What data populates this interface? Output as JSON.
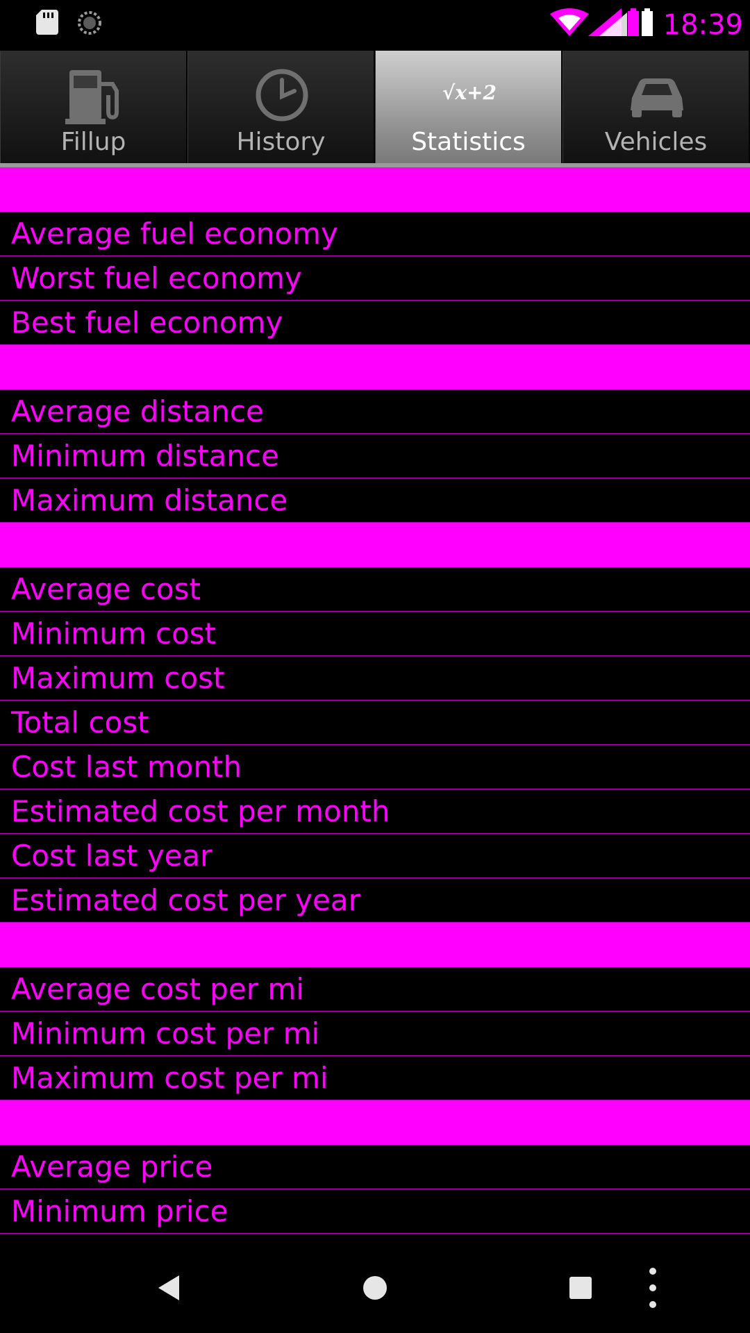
{
  "status_bar": {
    "time": "18:39",
    "icons": [
      "sd-card-icon",
      "sync-icon",
      "wifi-icon",
      "signal-icon",
      "battery-icon"
    ]
  },
  "tabs": [
    {
      "label": "Fillup",
      "icon": "fuel-pump-icon",
      "active": false
    },
    {
      "label": "History",
      "icon": "clock-icon",
      "active": false
    },
    {
      "label": "Statistics",
      "icon": "sqrt-formula-icon",
      "active": true,
      "icon_text": "√x+2"
    },
    {
      "label": "Vehicles",
      "icon": "car-icon",
      "active": false
    }
  ],
  "sections": [
    {
      "items": [
        "Average fuel economy",
        "Worst fuel economy",
        "Best fuel economy"
      ]
    },
    {
      "items": [
        "Average distance",
        "Minimum distance",
        "Maximum distance"
      ]
    },
    {
      "items": [
        "Average cost",
        "Minimum cost",
        "Maximum cost",
        "Total cost",
        "Cost last month",
        "Estimated cost per month",
        "Cost last year",
        "Estimated cost per year"
      ]
    },
    {
      "items": [
        "Average cost per mi",
        "Minimum cost per mi",
        "Maximum cost per mi"
      ]
    },
    {
      "items": [
        "Average price",
        "Minimum price"
      ]
    }
  ],
  "colors": {
    "accent": "#ff00ff",
    "background": "#000000",
    "divider": "#c000c0"
  },
  "nav_bar": {
    "buttons": [
      "back-icon",
      "home-icon",
      "recents-icon",
      "overflow-menu-icon"
    ]
  }
}
